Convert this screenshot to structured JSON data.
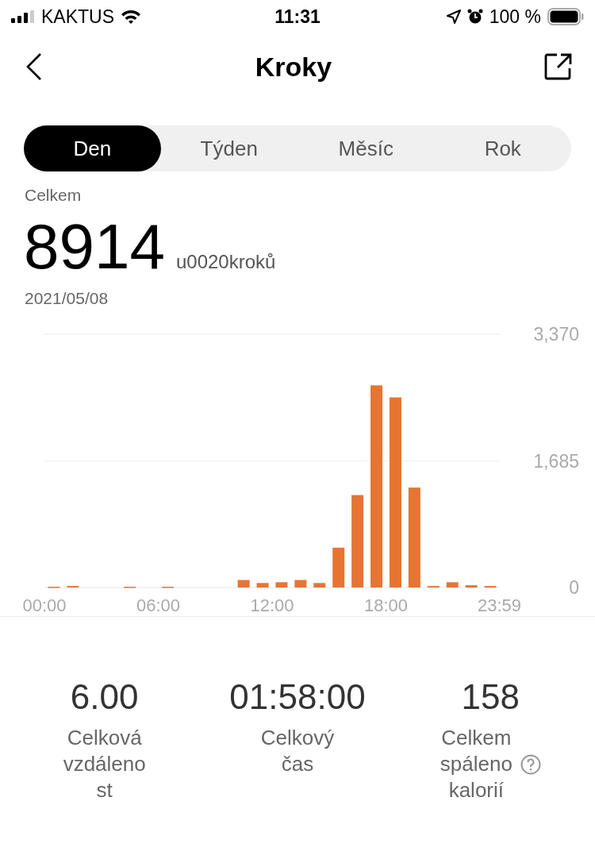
{
  "status_bar": {
    "carrier": "KAKTUS",
    "time": "11:31",
    "battery": "100 %"
  },
  "nav": {
    "title": "Kroky"
  },
  "tabs": [
    {
      "label": "Den",
      "selected": true
    },
    {
      "label": "Týden",
      "selected": false
    },
    {
      "label": "Měsíc",
      "selected": false
    },
    {
      "label": "Rok",
      "selected": false
    }
  ],
  "summary": {
    "label": "Celkem",
    "value": "8914",
    "unit": "u0020kroků",
    "date": "2021/05/08"
  },
  "chart_data": {
    "type": "bar",
    "x": [
      0.5,
      1.5,
      2.5,
      3.5,
      4.5,
      5.5,
      6.5,
      7.5,
      8.5,
      9.5,
      10.5,
      11.5,
      12.5,
      13.5,
      14.5,
      15.5,
      16.5,
      17.5,
      18.5,
      19.5,
      20.5,
      21.5,
      22.5,
      23.5
    ],
    "series": [
      {
        "color": "#e67533",
        "values": [
          10,
          20,
          0,
          0,
          10,
          0,
          10,
          0,
          0,
          0,
          100,
          60,
          70,
          100,
          60,
          530,
          1230,
          2690,
          2530,
          1330,
          20,
          70,
          30,
          20
        ]
      }
    ],
    "xlim": [
      0,
      24
    ],
    "ylim": [
      0,
      3370
    ],
    "yticks": [
      {
        "value": 0,
        "label": "0"
      },
      {
        "value": 1685,
        "label": "1,685"
      },
      {
        "value": 3370,
        "label": "3,370"
      }
    ],
    "xticks": [
      {
        "value": 0,
        "label": "00:00"
      },
      {
        "value": 6,
        "label": "06:00"
      },
      {
        "value": 12,
        "label": "12:00"
      },
      {
        "value": 18,
        "label": "18:00"
      },
      {
        "value": 23.98,
        "label": "23:59"
      }
    ]
  },
  "stats": [
    {
      "value": "6.00",
      "label_lines": [
        "Celková",
        "vzdáleno",
        "st"
      ],
      "help": false
    },
    {
      "value": "01:58:00",
      "label_lines": [
        "Celkový",
        "čas"
      ],
      "help": false
    },
    {
      "value": "158",
      "label_lines": [
        "Celkem",
        "spáleno",
        "kalorií"
      ],
      "help": true
    }
  ]
}
